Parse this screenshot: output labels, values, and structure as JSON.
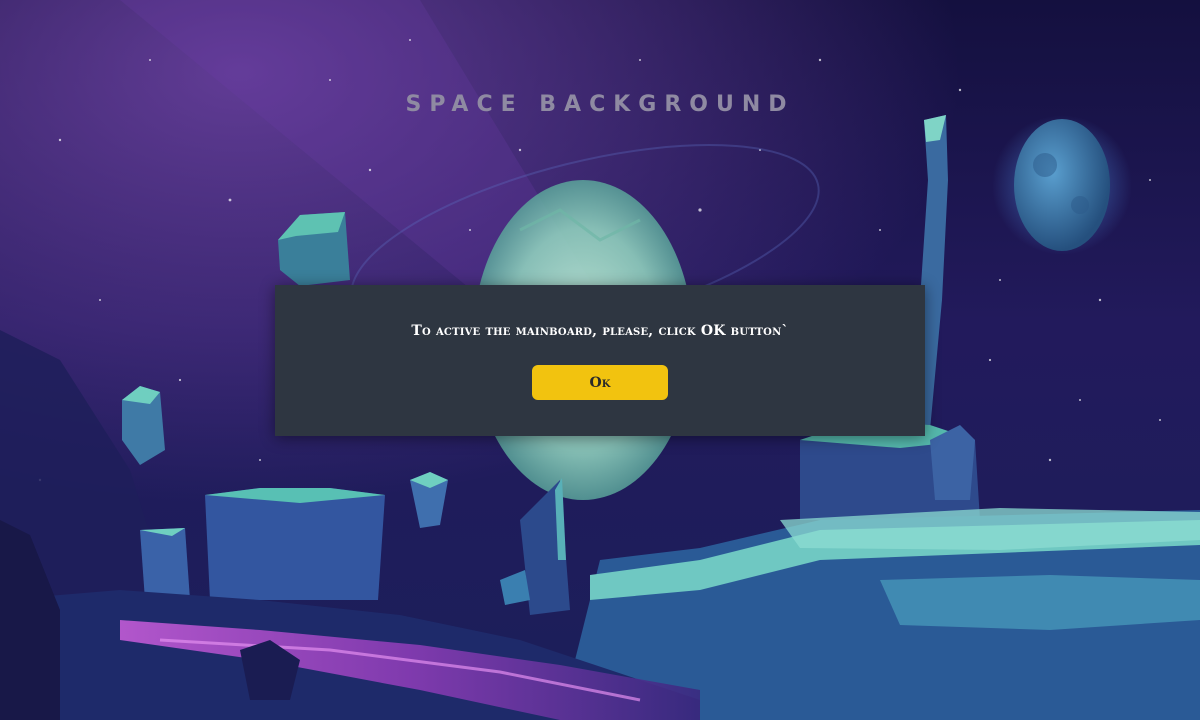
{
  "background": {
    "title": "SPACE BACKGROUND",
    "colors": {
      "sky_top": "#14103f",
      "sky_mid": "#2a1d6a",
      "nebula": "#6a3aa0",
      "planet_glow": "#9fd6c4",
      "moon": "#3f7fae",
      "rock_teal": "#3a9aa0",
      "rock_dark": "#243a78",
      "ground_glow": "#b04fc8"
    }
  },
  "dialog": {
    "message": "To active the mainboard, please, click OK button`",
    "ok_label": "Ok",
    "colors": {
      "panel": "#2e3641",
      "button": "#f2c30f",
      "text": "#ffffff"
    }
  }
}
